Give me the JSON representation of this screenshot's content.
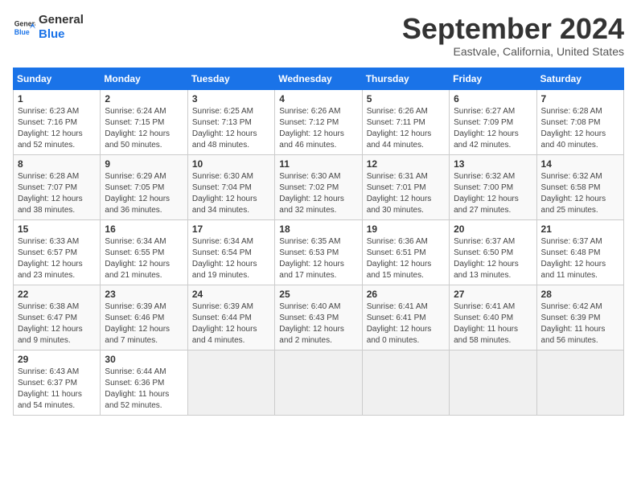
{
  "header": {
    "logo_line1": "General",
    "logo_line2": "Blue",
    "month": "September 2024",
    "location": "Eastvale, California, United States"
  },
  "weekdays": [
    "Sunday",
    "Monday",
    "Tuesday",
    "Wednesday",
    "Thursday",
    "Friday",
    "Saturday"
  ],
  "weeks": [
    [
      {
        "day": "1",
        "sunrise": "6:23 AM",
        "sunset": "7:16 PM",
        "daylight": "12 hours and 52 minutes."
      },
      {
        "day": "2",
        "sunrise": "6:24 AM",
        "sunset": "7:15 PM",
        "daylight": "12 hours and 50 minutes."
      },
      {
        "day": "3",
        "sunrise": "6:25 AM",
        "sunset": "7:13 PM",
        "daylight": "12 hours and 48 minutes."
      },
      {
        "day": "4",
        "sunrise": "6:26 AM",
        "sunset": "7:12 PM",
        "daylight": "12 hours and 46 minutes."
      },
      {
        "day": "5",
        "sunrise": "6:26 AM",
        "sunset": "7:11 PM",
        "daylight": "12 hours and 44 minutes."
      },
      {
        "day": "6",
        "sunrise": "6:27 AM",
        "sunset": "7:09 PM",
        "daylight": "12 hours and 42 minutes."
      },
      {
        "day": "7",
        "sunrise": "6:28 AM",
        "sunset": "7:08 PM",
        "daylight": "12 hours and 40 minutes."
      }
    ],
    [
      {
        "day": "8",
        "sunrise": "6:28 AM",
        "sunset": "7:07 PM",
        "daylight": "12 hours and 38 minutes."
      },
      {
        "day": "9",
        "sunrise": "6:29 AM",
        "sunset": "7:05 PM",
        "daylight": "12 hours and 36 minutes."
      },
      {
        "day": "10",
        "sunrise": "6:30 AM",
        "sunset": "7:04 PM",
        "daylight": "12 hours and 34 minutes."
      },
      {
        "day": "11",
        "sunrise": "6:30 AM",
        "sunset": "7:02 PM",
        "daylight": "12 hours and 32 minutes."
      },
      {
        "day": "12",
        "sunrise": "6:31 AM",
        "sunset": "7:01 PM",
        "daylight": "12 hours and 30 minutes."
      },
      {
        "day": "13",
        "sunrise": "6:32 AM",
        "sunset": "7:00 PM",
        "daylight": "12 hours and 27 minutes."
      },
      {
        "day": "14",
        "sunrise": "6:32 AM",
        "sunset": "6:58 PM",
        "daylight": "12 hours and 25 minutes."
      }
    ],
    [
      {
        "day": "15",
        "sunrise": "6:33 AM",
        "sunset": "6:57 PM",
        "daylight": "12 hours and 23 minutes."
      },
      {
        "day": "16",
        "sunrise": "6:34 AM",
        "sunset": "6:55 PM",
        "daylight": "12 hours and 21 minutes."
      },
      {
        "day": "17",
        "sunrise": "6:34 AM",
        "sunset": "6:54 PM",
        "daylight": "12 hours and 19 minutes."
      },
      {
        "day": "18",
        "sunrise": "6:35 AM",
        "sunset": "6:53 PM",
        "daylight": "12 hours and 17 minutes."
      },
      {
        "day": "19",
        "sunrise": "6:36 AM",
        "sunset": "6:51 PM",
        "daylight": "12 hours and 15 minutes."
      },
      {
        "day": "20",
        "sunrise": "6:37 AM",
        "sunset": "6:50 PM",
        "daylight": "12 hours and 13 minutes."
      },
      {
        "day": "21",
        "sunrise": "6:37 AM",
        "sunset": "6:48 PM",
        "daylight": "12 hours and 11 minutes."
      }
    ],
    [
      {
        "day": "22",
        "sunrise": "6:38 AM",
        "sunset": "6:47 PM",
        "daylight": "12 hours and 9 minutes."
      },
      {
        "day": "23",
        "sunrise": "6:39 AM",
        "sunset": "6:46 PM",
        "daylight": "12 hours and 7 minutes."
      },
      {
        "day": "24",
        "sunrise": "6:39 AM",
        "sunset": "6:44 PM",
        "daylight": "12 hours and 4 minutes."
      },
      {
        "day": "25",
        "sunrise": "6:40 AM",
        "sunset": "6:43 PM",
        "daylight": "12 hours and 2 minutes."
      },
      {
        "day": "26",
        "sunrise": "6:41 AM",
        "sunset": "6:41 PM",
        "daylight": "12 hours and 0 minutes."
      },
      {
        "day": "27",
        "sunrise": "6:41 AM",
        "sunset": "6:40 PM",
        "daylight": "11 hours and 58 minutes."
      },
      {
        "day": "28",
        "sunrise": "6:42 AM",
        "sunset": "6:39 PM",
        "daylight": "11 hours and 56 minutes."
      }
    ],
    [
      {
        "day": "29",
        "sunrise": "6:43 AM",
        "sunset": "6:37 PM",
        "daylight": "11 hours and 54 minutes."
      },
      {
        "day": "30",
        "sunrise": "6:44 AM",
        "sunset": "6:36 PM",
        "daylight": "11 hours and 52 minutes."
      },
      null,
      null,
      null,
      null,
      null
    ]
  ]
}
